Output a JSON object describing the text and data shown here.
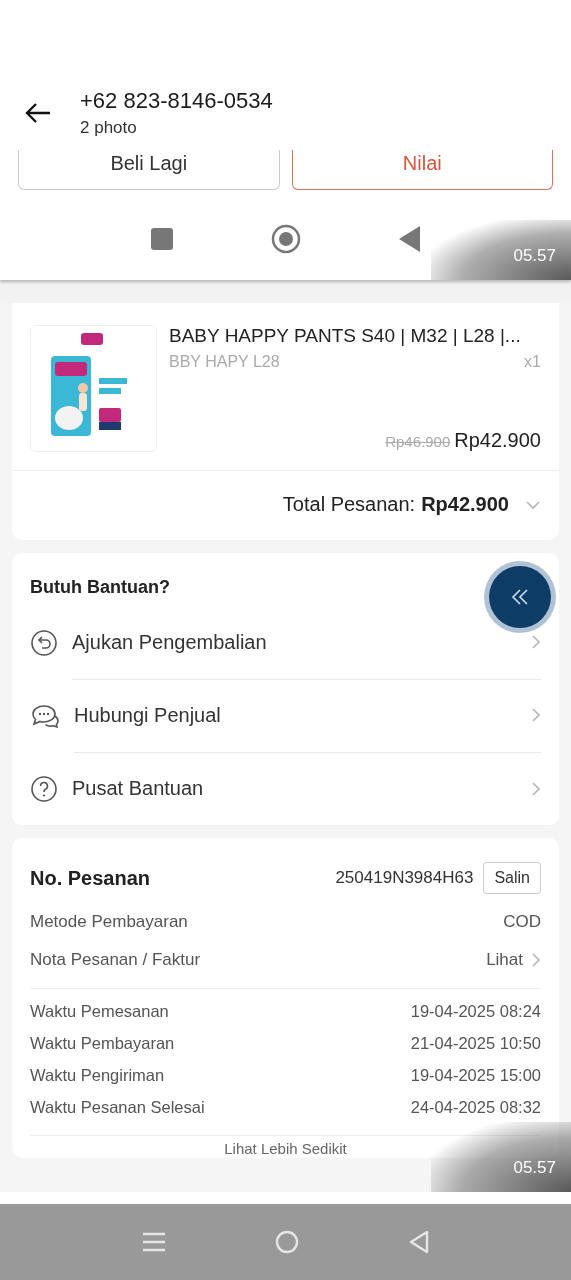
{
  "header": {
    "title": "+62 823-8146-0534",
    "subtitle": "2 photo"
  },
  "screenshot_top": {
    "buttons": [
      {
        "label": "Beli Lagi",
        "kind": "plain"
      },
      {
        "label": "Nilai",
        "kind": "primary"
      }
    ],
    "timestamp": "05.57"
  },
  "screenshot_bottom": {
    "product": {
      "kind": "picture",
      "name": "BABY HAPPY PANTS S40 | M32 | L28 |...",
      "variant": "BBY HAPY L28",
      "quantity": "x1",
      "original_price": "Rp46.900",
      "price": "Rp42.900",
      "total_label": "Total Pesanan:",
      "total": "Rp42.900"
    },
    "help": {
      "title": "Butuh Bantuan?",
      "items": [
        {
          "kind": "return",
          "label": "Ajukan Pengembalian"
        },
        {
          "kind": "chat",
          "label": "Hubungi Penjual"
        },
        {
          "kind": "question",
          "label": "Pusat Bantuan"
        }
      ]
    },
    "order": {
      "number_label": "No. Pesanan",
      "number": "250419N3984H63",
      "copy": "Salin",
      "details": [
        {
          "label": "Metode Pembayaran",
          "value": "COD",
          "kind": "text"
        },
        {
          "label": "Nota Pesanan / Faktur",
          "value": "Lihat",
          "kind": "link"
        }
      ],
      "times": [
        {
          "label": "Waktu Pemesanan",
          "value": "19-04-2025 08:24"
        },
        {
          "label": "Waktu Pembayaran",
          "value": "21-04-2025 10:50"
        },
        {
          "label": "Waktu Pengiriman",
          "value": "19-04-2025 15:00"
        },
        {
          "label": "Waktu Pesanan Selesai",
          "value": "24-04-2025 08:32"
        }
      ],
      "toggle": "Lihat Lebih Sedikit"
    },
    "timestamp": "05.57"
  }
}
